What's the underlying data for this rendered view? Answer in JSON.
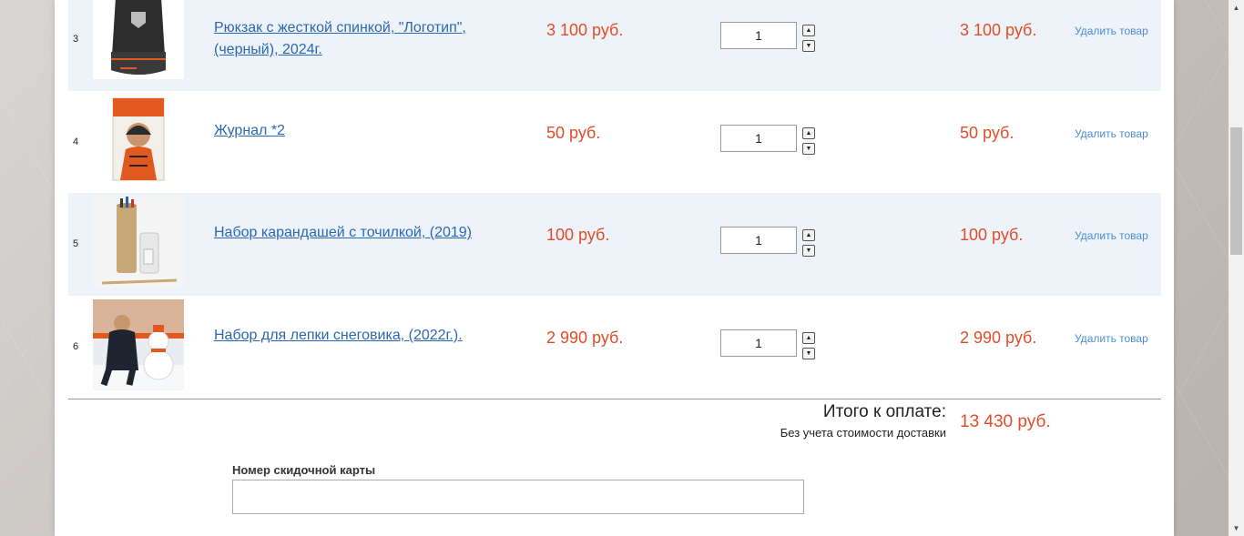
{
  "cart": {
    "items": [
      {
        "index": "3",
        "title_line1": "Рюкзак с жесткой спинкой, \"Логотип\",",
        "title_line2": "(черный), 2024г.",
        "price": "3 100 руб.",
        "quantity": "1",
        "total": "3 100 руб.",
        "remove_label": "Удалить товар",
        "image": "backpack"
      },
      {
        "index": "4",
        "title_line1": "Журнал *2",
        "title_line2": "",
        "price": "50 руб.",
        "quantity": "1",
        "total": "50 руб.",
        "remove_label": "Удалить товар",
        "image": "magazine"
      },
      {
        "index": "5",
        "title_line1": "Набор карандашей с точилкой, (2019)",
        "title_line2": "",
        "price": "100 руб.",
        "quantity": "1",
        "total": "100 руб.",
        "remove_label": "Удалить товар",
        "image": "pencil-set"
      },
      {
        "index": "6",
        "title_line1": "Набор для лепки снеговика, (2022г.).",
        "title_line2": "",
        "price": "2 990 руб.",
        "quantity": "1",
        "total": "2 990 руб.",
        "remove_label": "Удалить товар",
        "image": "snowman-kit"
      }
    ],
    "stepper_up_icon": "▲",
    "stepper_down_icon": "▼"
  },
  "summary": {
    "label": "Итого к оплате:",
    "note": "Без учета стоимости доставки",
    "value": "13 430 руб."
  },
  "discount": {
    "label": "Номер скидочной карты",
    "value": ""
  },
  "scrollbar": {
    "up_icon": "▲",
    "down_icon": "▼"
  },
  "colors": {
    "price": "#e04e28",
    "link": "#2a68b2",
    "remove_link": "#4a8fd0",
    "row_shade": "#eef2f9"
  }
}
